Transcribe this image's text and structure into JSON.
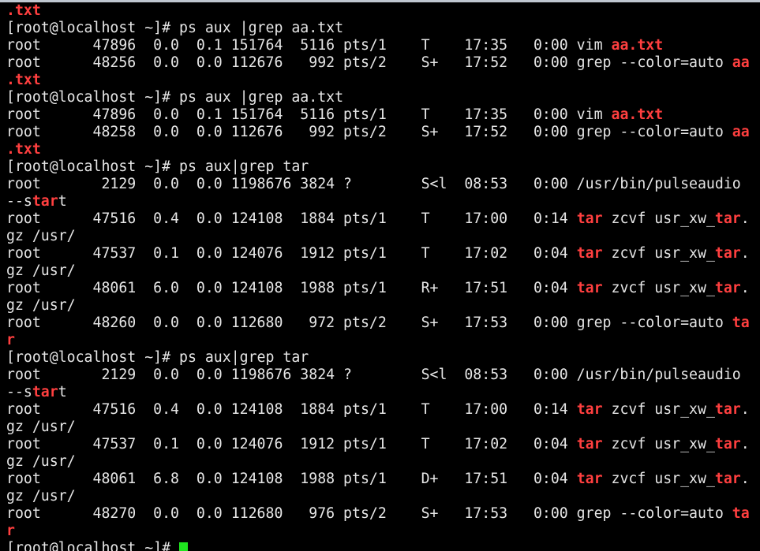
{
  "colors": {
    "background": "#000000",
    "text": "#e6e6e6",
    "match_highlight": "#ff3f3f",
    "cursor": "#1fe41f"
  },
  "terminal": {
    "lines": [
      [
        {
          "t": ".txt",
          "hl": true
        }
      ],
      [
        {
          "t": "[root@localhost ~]# ps aux |grep aa.txt"
        }
      ],
      [
        {
          "t": "root      47896  0.0  0.1 151764  5116 pts/1    T    17:35   0:00 vim "
        },
        {
          "t": "aa.txt",
          "hl": true
        }
      ],
      [
        {
          "t": "root      48256  0.0  0.0 112676   992 pts/2    S+   17:52   0:00 grep --color=auto "
        },
        {
          "t": "aa",
          "hl": true
        }
      ],
      [
        {
          "t": ".txt",
          "hl": true
        }
      ],
      [
        {
          "t": "[root@localhost ~]# ps aux |grep aa.txt"
        }
      ],
      [
        {
          "t": "root      47896  0.0  0.1 151764  5116 pts/1    T    17:35   0:00 vim "
        },
        {
          "t": "aa.txt",
          "hl": true
        }
      ],
      [
        {
          "t": "root      48258  0.0  0.0 112676   992 pts/2    S+   17:52   0:00 grep --color=auto "
        },
        {
          "t": "aa",
          "hl": true
        }
      ],
      [
        {
          "t": ".txt",
          "hl": true
        }
      ],
      [
        {
          "t": "[root@localhost ~]# ps aux|grep tar"
        }
      ],
      [
        {
          "t": "root       2129  0.0  0.0 1198676 3824 ?        S<l  08:53   0:00 /usr/bin/pulseaudio"
        }
      ],
      [
        {
          "t": "--s"
        },
        {
          "t": "tar",
          "hl": true
        },
        {
          "t": "t"
        }
      ],
      [
        {
          "t": "root      47516  0.4  0.0 124108  1884 pts/1    T    17:00   0:14 "
        },
        {
          "t": "tar",
          "hl": true
        },
        {
          "t": " zcvf usr_xw_"
        },
        {
          "t": "tar",
          "hl": true
        },
        {
          "t": "."
        }
      ],
      [
        {
          "t": "gz /usr/"
        }
      ],
      [
        {
          "t": "root      47537  0.1  0.0 124076  1912 pts/1    T    17:02   0:04 "
        },
        {
          "t": "tar",
          "hl": true
        },
        {
          "t": " zcvf usr_xw_"
        },
        {
          "t": "tar",
          "hl": true
        },
        {
          "t": "."
        }
      ],
      [
        {
          "t": "gz /usr/"
        }
      ],
      [
        {
          "t": "root      48061  6.0  0.0 124108  1988 pts/1    R+   17:51   0:04 "
        },
        {
          "t": "tar",
          "hl": true
        },
        {
          "t": " zvcf usr_xw_"
        },
        {
          "t": "tar",
          "hl": true
        },
        {
          "t": "."
        }
      ],
      [
        {
          "t": "gz /usr/"
        }
      ],
      [
        {
          "t": "root      48260  0.0  0.0 112680   972 pts/2    S+   17:53   0:00 grep --color=auto "
        },
        {
          "t": "ta",
          "hl": true
        }
      ],
      [
        {
          "t": "r",
          "hl": true
        }
      ],
      [
        {
          "t": "[root@localhost ~]# ps aux|grep tar"
        }
      ],
      [
        {
          "t": "root       2129  0.0  0.0 1198676 3824 ?        S<l  08:53   0:00 /usr/bin/pulseaudio"
        }
      ],
      [
        {
          "t": "--s"
        },
        {
          "t": "tar",
          "hl": true
        },
        {
          "t": "t"
        }
      ],
      [
        {
          "t": "root      47516  0.4  0.0 124108  1884 pts/1    T    17:00   0:14 "
        },
        {
          "t": "tar",
          "hl": true
        },
        {
          "t": " zcvf usr_xw_"
        },
        {
          "t": "tar",
          "hl": true
        },
        {
          "t": "."
        }
      ],
      [
        {
          "t": "gz /usr/"
        }
      ],
      [
        {
          "t": "root      47537  0.1  0.0 124076  1912 pts/1    T    17:02   0:04 "
        },
        {
          "t": "tar",
          "hl": true
        },
        {
          "t": " zcvf usr_xw_"
        },
        {
          "t": "tar",
          "hl": true
        },
        {
          "t": "."
        }
      ],
      [
        {
          "t": "gz /usr/"
        }
      ],
      [
        {
          "t": "root      48061  6.8  0.0 124108  1988 pts/1    D+   17:51   0:04 "
        },
        {
          "t": "tar",
          "hl": true
        },
        {
          "t": " zvcf usr_xw_"
        },
        {
          "t": "tar",
          "hl": true
        },
        {
          "t": "."
        }
      ],
      [
        {
          "t": "gz /usr/"
        }
      ],
      [
        {
          "t": "root      48270  0.0  0.0 112680   976 pts/2    S+   17:53   0:00 grep --color=auto "
        },
        {
          "t": "ta",
          "hl": true
        }
      ],
      [
        {
          "t": "r",
          "hl": true
        }
      ],
      [
        {
          "t": "[root@localhost ~]# "
        },
        {
          "cursor": true
        }
      ]
    ]
  }
}
